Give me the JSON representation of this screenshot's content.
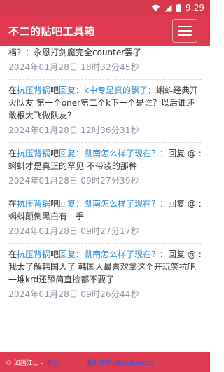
{
  "status_bar": {
    "time": "9:29"
  },
  "app_bar": {
    "title": "不二的贴吧工具箱"
  },
  "posts": [
    {
      "text": "档？：永恩打剑魔完全counter罢了",
      "time": "2024年01月28日 18时32分45秒"
    },
    {
      "prefix": "在",
      "forum": "抗压背锅",
      "mid": "吧",
      "reply_label": "回复",
      "colon1": "：",
      "topic": "k中专是真的飘了",
      "colon2": "：",
      "text": "蝌蚪经典开火队友 第一个oner第二个k下一个是谁？以后谁还敢根大飞做队友？",
      "time": "2024年01月28日 12时36分31秒"
    },
    {
      "prefix": "在",
      "forum": "抗压背锅",
      "mid": "吧",
      "reply_label": "回复",
      "colon1": "：",
      "topic": "凯南怎么样了现在？",
      "colon2": "：",
      "text": "回复 @ :蝌蚪才是真正的罕见 不带装的那种",
      "time": "2024年01月28日 09时27分39秒"
    },
    {
      "prefix": "在",
      "forum": "抗压背锅",
      "mid": "吧",
      "reply_label": "回复",
      "colon1": "：",
      "topic": "凯南怎么样了现在？",
      "colon2": "：",
      "text": "回复 @ :蝌蚪颠倒黑白有一手",
      "time": "2024年01月28日 09时27分17秒"
    },
    {
      "prefix": "在",
      "forum": "抗压背锅",
      "mid": "吧",
      "reply_label": "回复",
      "colon1": "：",
      "topic": "凯南怎么样了现在？",
      "colon2": "：",
      "text": "回复 @ :我太了解韩国人了 韩国人最喜欢拿这个开玩笑抗吧一堆krd还舔简直捡都不要了",
      "time": "2024年01月28日 09时26分44秒"
    }
  ],
  "footer": {
    "copyright": "© 如画江山 -",
    "author_link": "不二",
    "blog_link": "我的博客 blog.buer.cn"
  },
  "colors": {
    "accent": "#e03a50",
    "status_bar": "#d5384b",
    "link": "#2b8ad6",
    "timestamp": "#8a96a3"
  }
}
